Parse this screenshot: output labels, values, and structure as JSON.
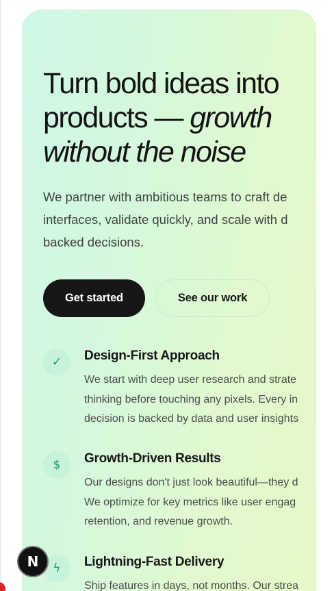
{
  "hero": {
    "headline_line1": "Turn bold ideas into",
    "headline_line2_plain": "products — ",
    "headline_line2_italic": "growth",
    "headline_line3_italic": "without the noise",
    "lede_lines": [
      "We partner with ambitious teams to craft de",
      "interfaces, validate quickly, and scale with d",
      "backed decisions."
    ],
    "primary_button": "Get started",
    "secondary_button": "See our work"
  },
  "features": [
    {
      "icon": "check-icon",
      "glyph": "✓",
      "title": "Design-First Approach",
      "lines": [
        "We start with deep user research and strate",
        "thinking before touching any pixels. Every in",
        "decision is backed by data and user insights"
      ]
    },
    {
      "icon": "dollar-icon",
      "glyph": "$",
      "title": "Growth-Driven Results",
      "lines": [
        "Our designs don't just look beautiful—they d",
        "We optimize for key metrics like user engag",
        "retention, and revenue growth."
      ]
    },
    {
      "icon": "lightning-icon",
      "glyph": "ϟ",
      "title": "Lightning-Fast Delivery",
      "lines": [
        "Ship features in days, not months. Our strea"
      ]
    }
  ],
  "dev_badge": {
    "letter": "N"
  },
  "colors": {
    "card_gradient_start": "#cdf7e6",
    "card_gradient_end": "#e6f9c8",
    "primary_button_bg": "#161616",
    "icon_accent": "#1a9670"
  }
}
